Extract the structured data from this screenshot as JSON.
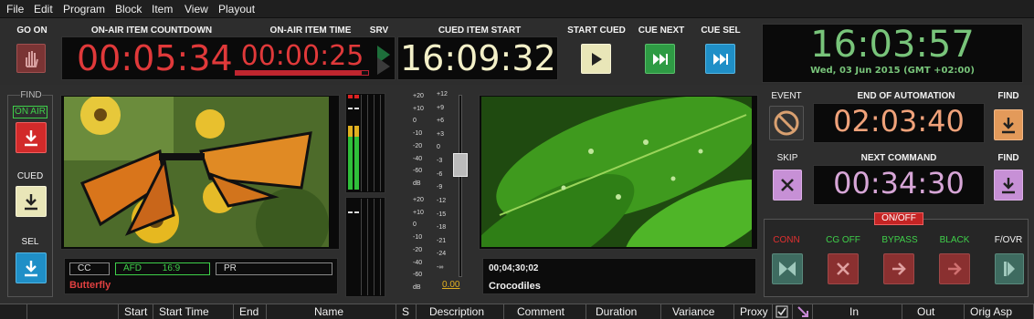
{
  "menu": [
    "File",
    "Edit",
    "Program",
    "Block",
    "Item",
    "View",
    "Playout"
  ],
  "top": {
    "go_on_label": "GO ON",
    "countdown_label": "ON-AIR ITEM COUNTDOWN",
    "countdown_value": "00:05:34",
    "item_time_label": "ON-AIR ITEM TIME",
    "item_time_value": "00:00:25",
    "item_progress": 0.95,
    "srv_label": "SRV",
    "cued_start_label": "CUED ITEM START",
    "cued_start_value": "16:09:32",
    "start_cued_label": "START CUED",
    "cue_next_label": "CUE NEXT",
    "cue_sel_label": "CUE SEL",
    "clock_time": "16:03:57",
    "clock_date": "Wed, 03 Jun 2015 (GMT +02:00)"
  },
  "left": {
    "find_label": "FIND",
    "on_air_label": "ON AIR",
    "cued_label": "CUED",
    "sel_label": "SEL"
  },
  "onair_preview": {
    "cc_label": "CC",
    "afd_label": "AFD",
    "afd_value": "16:9",
    "pr_label": "PR",
    "title": "Butterfly"
  },
  "audio": {
    "scale_top": [
      "+20",
      "+10",
      "0",
      "-10",
      "-20",
      "-40",
      "-60",
      "dB"
    ],
    "scale_bottom": [
      "+20",
      "+10",
      "0",
      "-10",
      "-20",
      "-40",
      "-60",
      "dB"
    ],
    "fader_scale": [
      "+12",
      "+9",
      "+6",
      "+3",
      "0",
      "-3",
      "-6",
      "-9",
      "-12",
      "-15",
      "-18",
      "-21",
      "-24",
      "-∞"
    ],
    "fader_value": "0.00"
  },
  "cued_preview": {
    "timecode": "00;04;30;02",
    "title": "Crocodiles"
  },
  "right": {
    "event_label": "EVENT",
    "end_automation_label": "END OF AUTOMATION",
    "end_automation_value": "02:03:40",
    "find_label_1": "FIND",
    "skip_label": "SKIP",
    "next_command_label": "NEXT COMMAND",
    "next_command_value": "00:34:30",
    "find_label_2": "FIND",
    "on_off_label": "ON/OFF",
    "conn_label": "CONN",
    "cg_off_label": "CG OFF",
    "bypass_label": "BYPASS",
    "black_label": "BLACK",
    "f_ovr_label": "F/OVR"
  },
  "table": {
    "columns": [
      "Start",
      "Start Time",
      "End",
      "Name",
      "S",
      "Description",
      "Comment",
      "Duration",
      "Variance",
      "Proxy",
      "",
      "",
      "In",
      "Out",
      "Orig Asp"
    ]
  },
  "colors": {
    "countdown": "#e0393a",
    "cued_start": "#f3f0c8",
    "clock": "#78c47a",
    "end_automation": "#f0a27a",
    "next_command": "#d7a6d7"
  }
}
